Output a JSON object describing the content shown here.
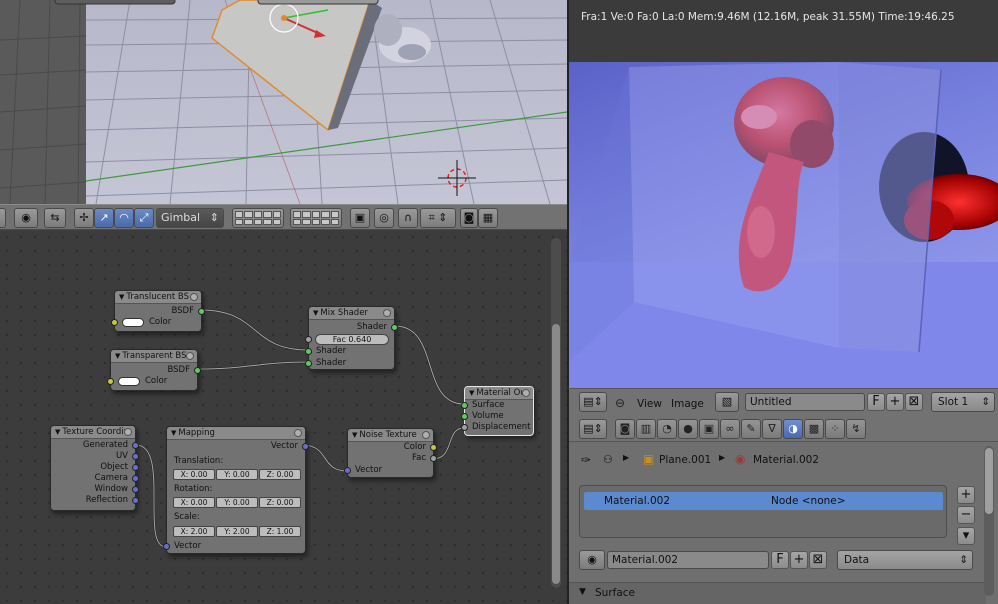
{
  "info": {
    "stats": "Fra:1  Ve:0 Fa:0 La:0 Mem:9.46M (12.16M, peak 31.55M) Time:19:46.25"
  },
  "viewport_header": {
    "orientation": "Gimbal"
  },
  "nodes": {
    "translucent": {
      "title": "Translucent BS",
      "output": "BSDF",
      "input": "Color"
    },
    "transparent": {
      "title": "Transparent BS",
      "output": "BSDF",
      "input": "Color"
    },
    "mix": {
      "title": "Mix Shader",
      "output": "Shader",
      "fac_label": "Fac 0.640",
      "shader1": "Shader",
      "shader2": "Shader"
    },
    "output": {
      "title": "Material Ou",
      "surface": "Surface",
      "volume": "Volume",
      "displacement": "Displacement"
    },
    "texcoord": {
      "title": "Texture Coordin",
      "outputs": [
        "Generated",
        "UV",
        "Object",
        "Camera",
        "Window",
        "Reflection"
      ]
    },
    "mapping": {
      "title": "Mapping",
      "output": "Vector",
      "translation_label": "Translation:",
      "rotation_label": "Rotation:",
      "scale_label": "Scale:",
      "translation": [
        "X: 0.00",
        "Y: 0.00",
        "Z: 0.00"
      ],
      "rotation": [
        "X: 0.00",
        "Y: 0.00",
        "Z: 0.00"
      ],
      "scale": [
        "X: 2.00",
        "Y: 2.00",
        "Z: 1.00"
      ],
      "input": "Vector"
    },
    "noise": {
      "title": "Noise Texture",
      "out_color": "Color",
      "out_fac": "Fac",
      "input": "Vector"
    }
  },
  "image_header": {
    "view": "View",
    "image": "Image",
    "image_name": "Untitled",
    "fake_user": "F",
    "slot": "Slot 1"
  },
  "properties": {
    "breadcrumb_object": "Plane.001",
    "breadcrumb_material": "Material.002",
    "slot_item_name": "Material.002",
    "slot_item_node": "Node <none>",
    "material_name": "Material.002",
    "fake_user": "F",
    "link_type": "Data",
    "surface_panel": "Surface"
  },
  "colors": {
    "accent": "#5b8ad0",
    "socket_shader": "#62c862",
    "socket_color": "#c8c83a",
    "socket_vector": "#6c6cd0"
  }
}
